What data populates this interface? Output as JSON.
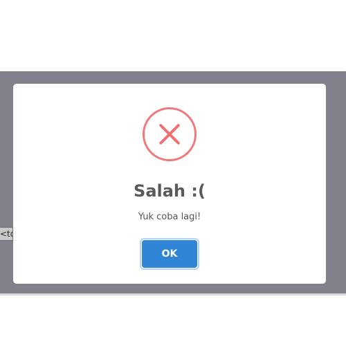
{
  "background_text": {
    "underlying_tag": "<td"
  },
  "dialog": {
    "icon": "error-x-icon",
    "title": "Salah :(",
    "message": "Yuk coba lagi!",
    "ok_label": "OK"
  },
  "colors": {
    "overlay": "#80818a",
    "error_icon": "#f0777a",
    "confirm_button": "#3085d6",
    "title_text": "#595959"
  }
}
